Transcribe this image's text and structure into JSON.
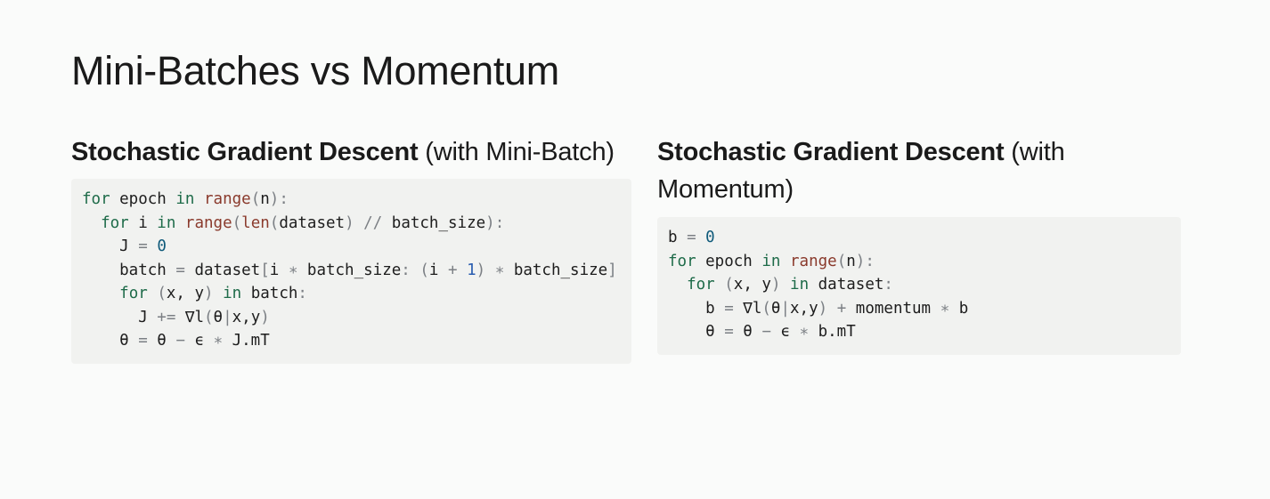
{
  "slide": {
    "title": "Mini-Batches vs Momentum"
  },
  "left": {
    "heading_bold": "Stochastic Gradient Descent",
    "heading_rest": " (with Mini-Batch)",
    "code": [
      [
        {
          "t": "kw",
          "v": "for"
        },
        {
          "t": "txt",
          "v": " epoch "
        },
        {
          "t": "kw",
          "v": "in"
        },
        {
          "t": "txt",
          "v": " "
        },
        {
          "t": "fn",
          "v": "range"
        },
        {
          "t": "op",
          "v": "("
        },
        {
          "t": "txt",
          "v": "n"
        },
        {
          "t": "op",
          "v": "):"
        }
      ],
      [
        {
          "t": "txt",
          "v": "  "
        },
        {
          "t": "kw",
          "v": "for"
        },
        {
          "t": "txt",
          "v": " i "
        },
        {
          "t": "kw",
          "v": "in"
        },
        {
          "t": "txt",
          "v": " "
        },
        {
          "t": "fn",
          "v": "range"
        },
        {
          "t": "op",
          "v": "("
        },
        {
          "t": "fn",
          "v": "len"
        },
        {
          "t": "op",
          "v": "("
        },
        {
          "t": "txt",
          "v": "dataset"
        },
        {
          "t": "op",
          "v": ")"
        },
        {
          "t": "txt",
          "v": " "
        },
        {
          "t": "op",
          "v": "//"
        },
        {
          "t": "txt",
          "v": " batch_size"
        },
        {
          "t": "op",
          "v": "):"
        }
      ],
      [
        {
          "t": "txt",
          "v": "    J "
        },
        {
          "t": "op",
          "v": "="
        },
        {
          "t": "txt",
          "v": " "
        },
        {
          "t": "num0",
          "v": "0"
        }
      ],
      [
        {
          "t": "txt",
          "v": "    batch "
        },
        {
          "t": "op",
          "v": "="
        },
        {
          "t": "txt",
          "v": " dataset"
        },
        {
          "t": "op",
          "v": "["
        },
        {
          "t": "txt",
          "v": "i "
        },
        {
          "t": "op",
          "v": "∗"
        },
        {
          "t": "txt",
          "v": " batch_size"
        },
        {
          "t": "op",
          "v": ":"
        },
        {
          "t": "txt",
          "v": " "
        },
        {
          "t": "op",
          "v": "("
        },
        {
          "t": "txt",
          "v": "i "
        },
        {
          "t": "op",
          "v": "+"
        },
        {
          "t": "txt",
          "v": " "
        },
        {
          "t": "num",
          "v": "1"
        },
        {
          "t": "op",
          "v": ")"
        },
        {
          "t": "txt",
          "v": " "
        },
        {
          "t": "op",
          "v": "∗"
        },
        {
          "t": "txt",
          "v": " batch_size"
        },
        {
          "t": "op",
          "v": "]"
        }
      ],
      [
        {
          "t": "txt",
          "v": "    "
        },
        {
          "t": "kw",
          "v": "for"
        },
        {
          "t": "txt",
          "v": " "
        },
        {
          "t": "op",
          "v": "("
        },
        {
          "t": "txt",
          "v": "x, y"
        },
        {
          "t": "op",
          "v": ")"
        },
        {
          "t": "txt",
          "v": " "
        },
        {
          "t": "kw",
          "v": "in"
        },
        {
          "t": "txt",
          "v": " batch"
        },
        {
          "t": "op",
          "v": ":"
        }
      ],
      [
        {
          "t": "txt",
          "v": "      J "
        },
        {
          "t": "op",
          "v": "+="
        },
        {
          "t": "txt",
          "v": " ∇l"
        },
        {
          "t": "op",
          "v": "("
        },
        {
          "t": "txt",
          "v": "θ"
        },
        {
          "t": "op",
          "v": "|"
        },
        {
          "t": "txt",
          "v": "x,y"
        },
        {
          "t": "op",
          "v": ")"
        }
      ],
      [
        {
          "t": "txt",
          "v": "    θ "
        },
        {
          "t": "op",
          "v": "="
        },
        {
          "t": "txt",
          "v": " θ "
        },
        {
          "t": "op",
          "v": "−"
        },
        {
          "t": "txt",
          "v": " ϵ "
        },
        {
          "t": "op",
          "v": "∗"
        },
        {
          "t": "txt",
          "v": " J.mT"
        }
      ]
    ]
  },
  "right": {
    "heading_bold": "Stochastic Gradient Descent",
    "heading_rest": " (with Momentum)",
    "code": [
      [
        {
          "t": "txt",
          "v": "b "
        },
        {
          "t": "op",
          "v": "="
        },
        {
          "t": "txt",
          "v": " "
        },
        {
          "t": "num0",
          "v": "0"
        }
      ],
      [
        {
          "t": "kw",
          "v": "for"
        },
        {
          "t": "txt",
          "v": " epoch "
        },
        {
          "t": "kw",
          "v": "in"
        },
        {
          "t": "txt",
          "v": " "
        },
        {
          "t": "fn",
          "v": "range"
        },
        {
          "t": "op",
          "v": "("
        },
        {
          "t": "txt",
          "v": "n"
        },
        {
          "t": "op",
          "v": "):"
        }
      ],
      [
        {
          "t": "txt",
          "v": "  "
        },
        {
          "t": "kw",
          "v": "for"
        },
        {
          "t": "txt",
          "v": " "
        },
        {
          "t": "op",
          "v": "("
        },
        {
          "t": "txt",
          "v": "x, y"
        },
        {
          "t": "op",
          "v": ")"
        },
        {
          "t": "txt",
          "v": " "
        },
        {
          "t": "kw",
          "v": "in"
        },
        {
          "t": "txt",
          "v": " dataset"
        },
        {
          "t": "op",
          "v": ":"
        }
      ],
      [
        {
          "t": "txt",
          "v": "    b "
        },
        {
          "t": "op",
          "v": "="
        },
        {
          "t": "txt",
          "v": " ∇l"
        },
        {
          "t": "op",
          "v": "("
        },
        {
          "t": "txt",
          "v": "θ"
        },
        {
          "t": "op",
          "v": "|"
        },
        {
          "t": "txt",
          "v": "x,y"
        },
        {
          "t": "op",
          "v": ")"
        },
        {
          "t": "txt",
          "v": " "
        },
        {
          "t": "op",
          "v": "+"
        },
        {
          "t": "txt",
          "v": " momentum "
        },
        {
          "t": "op",
          "v": "∗"
        },
        {
          "t": "txt",
          "v": " b"
        }
      ],
      [
        {
          "t": "txt",
          "v": "    θ "
        },
        {
          "t": "op",
          "v": "="
        },
        {
          "t": "txt",
          "v": " θ "
        },
        {
          "t": "op",
          "v": "−"
        },
        {
          "t": "txt",
          "v": " ϵ "
        },
        {
          "t": "op",
          "v": "∗"
        },
        {
          "t": "txt",
          "v": " b.mT"
        }
      ]
    ]
  }
}
